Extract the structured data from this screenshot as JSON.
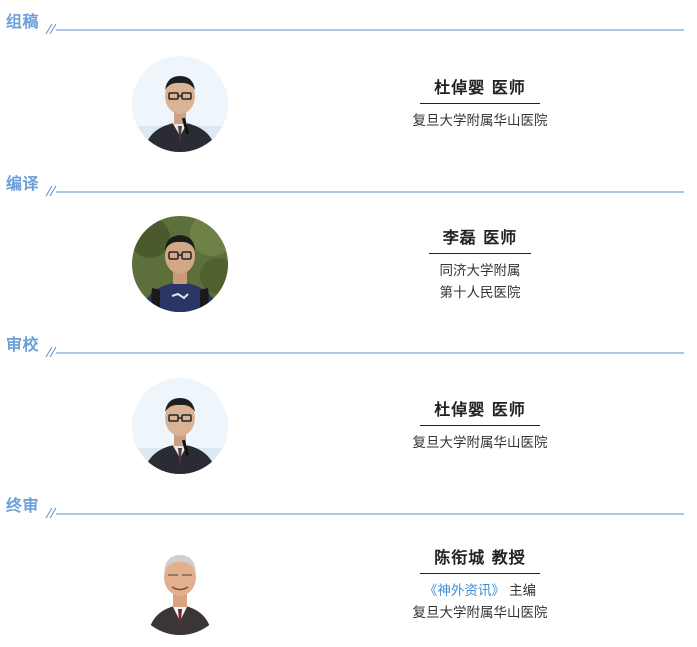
{
  "sections": [
    {
      "title": "组稿",
      "person": {
        "name": "杜倬婴 医师",
        "lines": [
          "复旦大学附属华山医院"
        ],
        "photo": "portrait-man-glasses-suit"
      }
    },
    {
      "title": "编译",
      "person": {
        "name": "李磊 医师",
        "lines": [
          "同济大学附属",
          "第十人民医院"
        ],
        "photo": "portrait-young-man-backpack"
      }
    },
    {
      "title": "审校",
      "person": {
        "name": "杜倬婴 医师",
        "lines": [
          "复旦大学附属华山医院"
        ],
        "photo": "portrait-man-glasses-suit"
      }
    },
    {
      "title": "终审",
      "person": {
        "name": "陈衔城 教授",
        "magazine": "《神外资讯》",
        "role": "主编",
        "lines": [
          "复旦大学附属华山医院"
        ],
        "photo": "portrait-senior-man-suit"
      }
    }
  ],
  "colors": {
    "accent": "#6a9fd8",
    "rule": "#5b8fd0",
    "link": "#3d8fd8"
  }
}
